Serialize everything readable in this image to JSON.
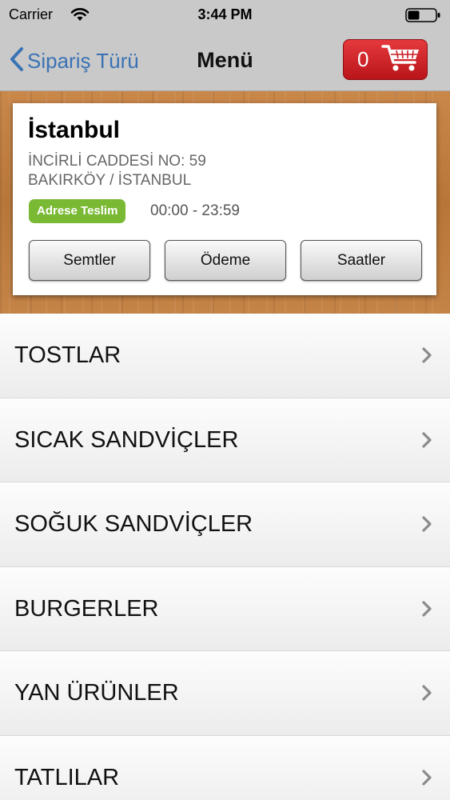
{
  "status_bar": {
    "carrier": "Carrier",
    "time": "3:44 PM"
  },
  "nav": {
    "back_label": "Sipariş Türü",
    "title": "Menü",
    "cart_count": "0"
  },
  "branch": {
    "name": "İstanbul",
    "address_line1": "İNCİRLİ CADDESİ NO: 59",
    "address_line2": "BAKIRKÖY / İSTANBUL",
    "delivery_badge": "Adrese Teslim",
    "hours": "00:00 - 23:59",
    "buttons": {
      "districts": "Semtler",
      "payment": "Ödeme",
      "hours": "Saatler"
    }
  },
  "categories": [
    {
      "label": "TOSTLAR"
    },
    {
      "label": "SICAK SANDVİÇLER"
    },
    {
      "label": "SOĞUK SANDVİÇLER"
    },
    {
      "label": "BURGERLER"
    },
    {
      "label": "YAN ÜRÜNLER"
    },
    {
      "label": "TATLILAR"
    }
  ],
  "colors": {
    "accent": "#3a73b5",
    "cart_red": "#d42328",
    "badge_green": "#7ab934"
  }
}
